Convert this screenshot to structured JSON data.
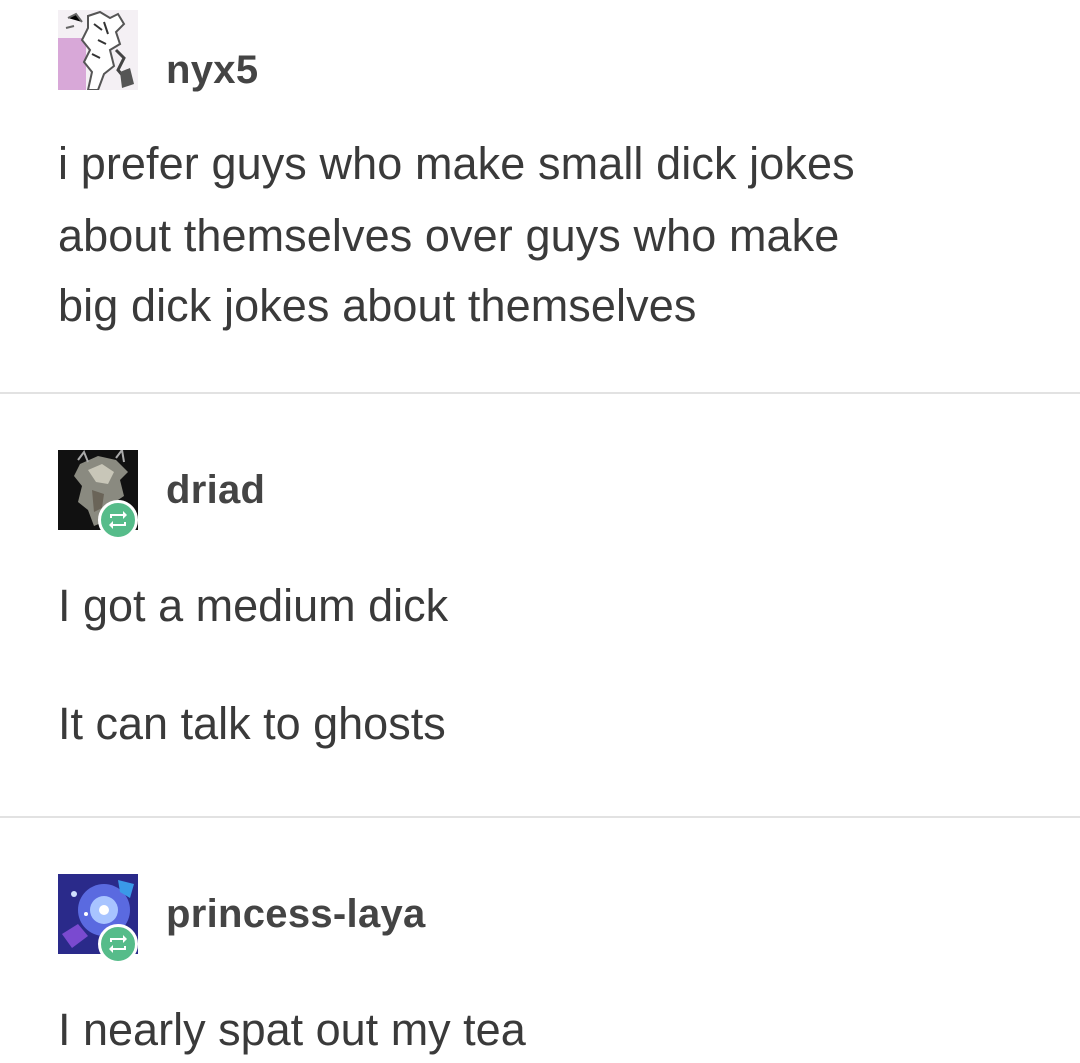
{
  "posts": [
    {
      "username": "nyx5",
      "avatar_icon": "manga-character-avatar",
      "reblog": false,
      "lines": [
        "i prefer guys who make small dick jokes",
        "about themselves over guys who make",
        "big dick jokes about themselves"
      ]
    },
    {
      "username": "driad",
      "avatar_icon": "dark-horse-avatar",
      "reblog": true,
      "paragraphs": [
        "I got a medium dick",
        "It can talk to ghosts"
      ]
    },
    {
      "username": "princess-laya",
      "avatar_icon": "blue-galaxy-avatar",
      "reblog": true,
      "paragraphs": [
        "I nearly spat out my tea"
      ]
    }
  ],
  "colors": {
    "text": "#3a3a3a",
    "divider": "#e2e2e2",
    "reblog_badge": "#56bc8a"
  }
}
